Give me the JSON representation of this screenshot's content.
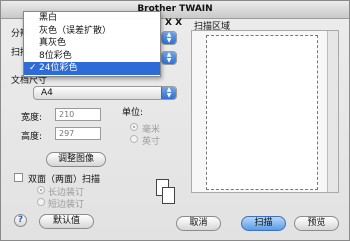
{
  "window": {
    "title": "Brother TWAIN"
  },
  "partial_labels": {
    "left1": "分辨",
    "right1": "X X",
    "left2": "扫描"
  },
  "menu": {
    "items": [
      {
        "label": "黑白",
        "selected": false
      },
      {
        "label": "灰色（误差扩散）",
        "selected": false
      },
      {
        "label": "真灰色",
        "selected": false
      },
      {
        "label": "8位彩色",
        "selected": false
      },
      {
        "label": "24位彩色",
        "selected": true,
        "check": "✓"
      }
    ]
  },
  "document_size": {
    "label": "文档尺寸",
    "value": "A4"
  },
  "width": {
    "label": "宽度:",
    "value": "210"
  },
  "height": {
    "label": "高度:",
    "value": "297"
  },
  "unit": {
    "label": "单位:",
    "options": [
      "毫米",
      "英寸"
    ],
    "selected": "毫米"
  },
  "adjust_button": "调整图像",
  "duplex": {
    "label": "双面（两面）扫描",
    "options": [
      "长边装订",
      "短边装订"
    ]
  },
  "scan_area_label": "扫描区域",
  "buttons": {
    "help": "?",
    "default": "默认值",
    "cancel": "取消",
    "scan": "扫描",
    "preview": "预览"
  },
  "colors": {
    "accent": "#2f6bd6",
    "default_button": "#5d9be6"
  }
}
